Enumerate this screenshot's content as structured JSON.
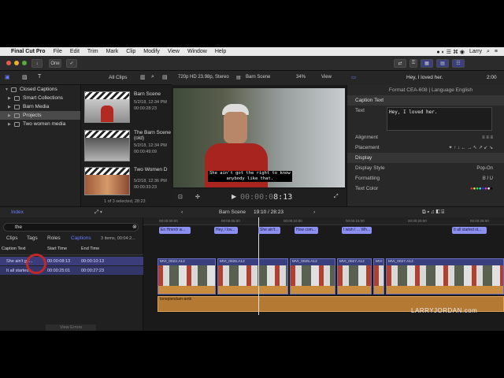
{
  "menubar": {
    "app_name": "Final Cut Pro",
    "items": [
      "File",
      "Edit",
      "Trim",
      "Mark",
      "Clip",
      "Modify",
      "View",
      "Window",
      "Help"
    ],
    "user": "Larry"
  },
  "toolbar": {
    "one_label": "One"
  },
  "browser": {
    "filter_label": "All Clips",
    "library": [
      {
        "label": "Closed Captions",
        "level": 0,
        "selected": false
      },
      {
        "label": "Smart Collections",
        "level": 1,
        "selected": false
      },
      {
        "label": "Barn Media",
        "level": 1,
        "selected": false
      },
      {
        "label": "Projects",
        "level": 1,
        "selected": true
      },
      {
        "label": "Two women media",
        "level": 1,
        "selected": false
      }
    ],
    "clips": [
      {
        "name": "Barn Scene",
        "date": "5/2/18, 12:34 PM",
        "duration": "00:00:28:23"
      },
      {
        "name": "The Barn Scene (old)",
        "date": "5/2/18, 12:34 PM",
        "duration": "00:00:49:09"
      },
      {
        "name": "Two Women D",
        "date": "5/2/18, 12:36 PM",
        "duration": "00:00:33:23"
      }
    ],
    "footer": "1 of 3 selected, 28:23"
  },
  "viewer": {
    "format": "720p HD 23.98p, Stereo",
    "project": "Barn Scene",
    "zoom": "34%",
    "view_label": "View",
    "caption_line1": "She ain't got the right to know",
    "caption_line2": "anybody like that.",
    "timecode": "8:13",
    "timecode_prefix": "00:00:0"
  },
  "inspector": {
    "caption_text": "Hey, I loved her.",
    "time": "2:00",
    "format_line": "Format CEA-608 | Language English",
    "section_caption": "Caption Text",
    "text_label": "Text",
    "rows": [
      {
        "label": "Alignment",
        "value": ""
      },
      {
        "label": "Placement",
        "value": ""
      }
    ],
    "display_head": "Display",
    "display_rows": [
      {
        "label": "Display Style",
        "value": "Pop-On"
      },
      {
        "label": "Formatting",
        "value": ""
      },
      {
        "label": "Text Color",
        "value": ""
      }
    ]
  },
  "timeline_bar": {
    "index_label": "Index",
    "project": "Barn Scene",
    "position": "19:10 / 28:23"
  },
  "index": {
    "search_value": "the",
    "tabs": [
      "Clips",
      "Tags",
      "Roles",
      "Captions"
    ],
    "count": "3 items, 00:04:2...",
    "headers": [
      "Caption Text",
      "Start Time",
      "End Time"
    ],
    "rows": [
      {
        "text": "She ain't go...",
        "start": "00:00:08:13",
        "end": "00:00:10:13"
      },
      {
        "text": "It all started...",
        "start": "00:00:25:01",
        "end": "00:00:27:23"
      }
    ],
    "view_errors": "View Errors"
  },
  "timeline": {
    "ruler": [
      "00:00:00:00",
      "00:00:05:00",
      "00:00:10:00",
      "00:00:15:00",
      "00:00:20:00",
      "00:00:25:00"
    ],
    "caption_clips": [
      "En Hmmh w...",
      "Hey, I lov...",
      "She ain't...",
      "How com...",
      "I wish I ... Wh...",
      "It all started st..."
    ],
    "primary_clips": [
      "MVI_0022.A12",
      "MVI_0026.A12",
      "MVI_0025.A12",
      "MVI_0027.A12",
      "MVI",
      "MVI_0027.A12"
    ],
    "audio_label": "tonepiendam-amb",
    "watermark": "LARRYJORDAN.com"
  }
}
